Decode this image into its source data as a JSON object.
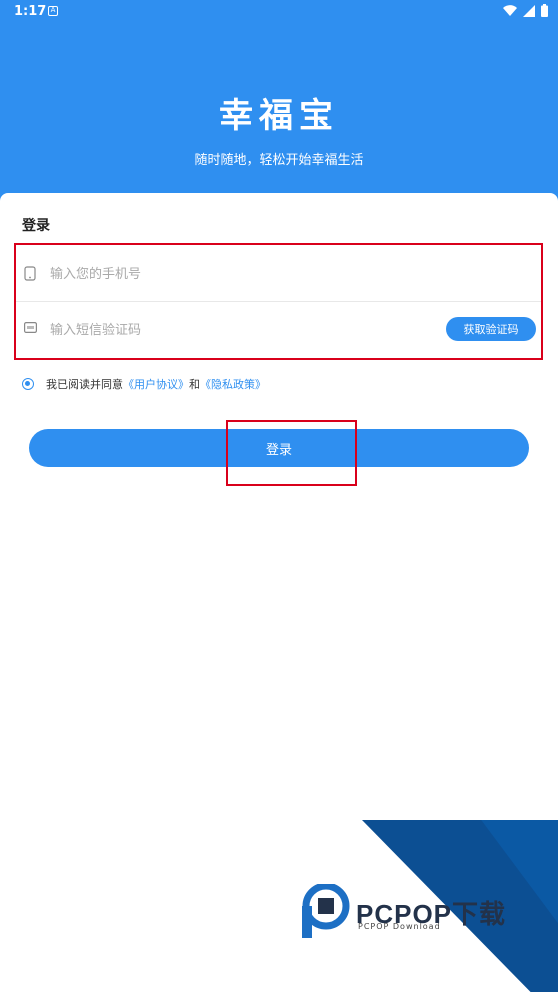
{
  "status": {
    "time": "1:17"
  },
  "app": {
    "title": "幸福宝",
    "subtitle": "随时随地，轻松开始幸福生活"
  },
  "login": {
    "title": "登录",
    "phone_placeholder": "输入您的手机号",
    "code_placeholder": "输入短信验证码",
    "get_code_label": "获取验证码",
    "agree_prefix": "我已阅读并同意",
    "user_agreement": "《用户协议》",
    "and": "和",
    "privacy_policy": "《隐私政策》",
    "submit_label": "登录"
  },
  "watermark": {
    "brand": "PCPOP下载",
    "sub": "PCPOP Download"
  },
  "colors": {
    "accent": "#2f8ff0",
    "highlight": "#d9001b",
    "watermark": "#0c4f93"
  }
}
